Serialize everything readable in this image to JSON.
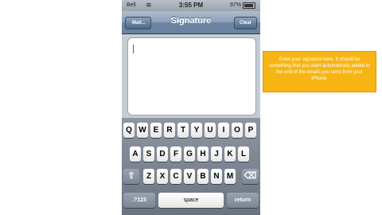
{
  "status_bar": {
    "carrier": "Bell",
    "time": "3:55 PM",
    "battery": "97%"
  },
  "nav": {
    "back_label": "Mail...",
    "title": "Signature",
    "clear_label": "Clear"
  },
  "keyboard": {
    "row1": [
      "Q",
      "W",
      "E",
      "R",
      "T",
      "Y",
      "U",
      "I",
      "O",
      "P"
    ],
    "row2": [
      "A",
      "S",
      "D",
      "F",
      "G",
      "H",
      "J",
      "K",
      "L"
    ],
    "row3": [
      "Z",
      "X",
      "C",
      "V",
      "B",
      "N",
      "M"
    ],
    "numbers_label": ".?123",
    "space_label": "space",
    "return_label": "return",
    "shift_icon": "⇧",
    "delete_icon": "⌫"
  },
  "callout": {
    "text": "Enter your signature here. It should be something that you want automatically added to the end of the emails you send from your iPhone."
  }
}
